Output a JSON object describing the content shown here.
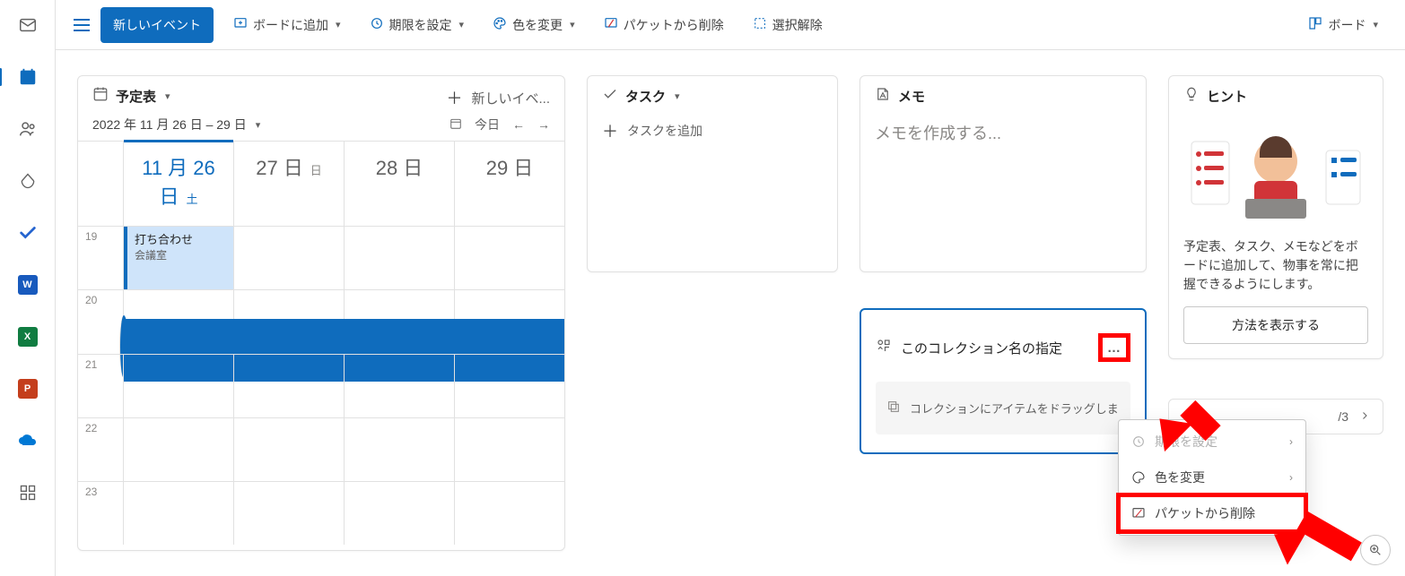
{
  "toolbar": {
    "new_event": "新しいイベント",
    "add_to_board": "ボードに追加",
    "set_due": "期限を設定",
    "change_color": "色を変更",
    "remove_bucket": "パケットから削除",
    "deselect": "選択解除",
    "board_view": "ボード"
  },
  "calendar": {
    "title": "予定表",
    "new_event_short": "新しいイベ...",
    "range": "2022 年 11 月 26 日 – 29 日",
    "today": "今日",
    "days": [
      {
        "num": "11 月 26 日",
        "dow": "土",
        "today": true
      },
      {
        "num": "27 日",
        "dow": "日",
        "today": false
      },
      {
        "num": "28 日",
        "dow": "",
        "today": false
      },
      {
        "num": "29 日",
        "dow": "",
        "today": false
      }
    ],
    "hours": [
      "19",
      "20",
      "21",
      "22",
      "23"
    ],
    "event": {
      "title": "打ち合わせ",
      "location": "会議室"
    }
  },
  "tasks": {
    "title": "タスク",
    "add": "タスクを追加"
  },
  "memo": {
    "title": "メモ",
    "placeholder": "メモを作成する..."
  },
  "collection": {
    "title": "このコレクション名の指定",
    "drag_hint": "コレクションにアイテムをドラッグしま"
  },
  "hint": {
    "title": "ヒント",
    "body": "予定表、タスク、メモなどをボードに追加して、物事を常に把握できるようにします。",
    "cta": "方法を表示する",
    "pager": "/3"
  },
  "context_menu": {
    "set_due": "期限を設定",
    "change_color": "色を変更",
    "remove_bucket": "パケットから削除"
  },
  "icons": {
    "calendar": "📅",
    "clock": "🕘",
    "palette": "🎨",
    "bucket_remove": "⧉",
    "deselect": "⬚",
    "board": "▦",
    "task_check": "✓",
    "memo": "A]",
    "collection": "⧉",
    "lightbulb": "💡",
    "chev_down": "▾",
    "chev_left": "←",
    "chev_right": "→",
    "plus": "＋",
    "more": "…",
    "zoom": "🔍"
  }
}
